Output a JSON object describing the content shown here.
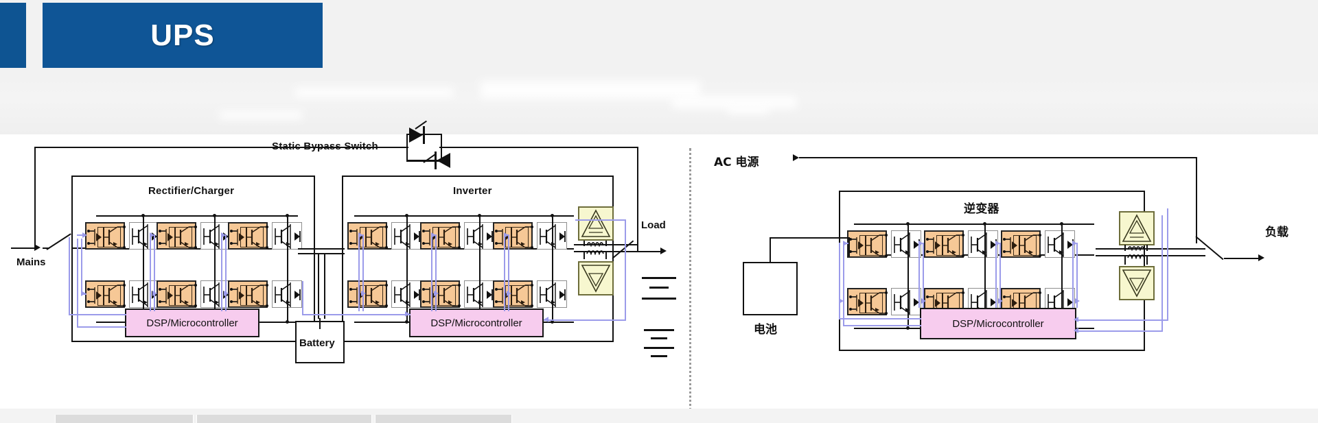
{
  "slide": {
    "title": "UPS",
    "title_color": "#0f5596",
    "accent_color": "#0e5492",
    "background": "#ffffff",
    "header_background": "#f2f2f2"
  },
  "palette": {
    "gate_driver": "#f6c896",
    "amp_block": "#f7f7cf",
    "dsp_block": "#f7ccee",
    "control_wire": "#9b9bea",
    "power_wire": "#111111"
  },
  "left_diagram": {
    "name": "UPS double-conversion block diagram",
    "labels": {
      "static_bypass_switch": "Static Bypass Switch",
      "rectifier_charger": "Rectifier/Charger",
      "inverter": "Inverter",
      "mains": "Mains",
      "load": "Load",
      "battery": "Battery",
      "dsp_rectifier": "DSP/Microcontroller",
      "dsp_inverter": "DSP/Microcontroller"
    },
    "stage_count": 3,
    "rails": 2
  },
  "right_diagram": {
    "name": "Inverter block diagram (Chinese)",
    "labels": {
      "ac_source": "AC 电源",
      "inverter": "逆变器",
      "battery": "电池",
      "load": "负载",
      "dsp": "DSP/Microcontroller"
    },
    "stage_count": 3,
    "rails": 2
  }
}
